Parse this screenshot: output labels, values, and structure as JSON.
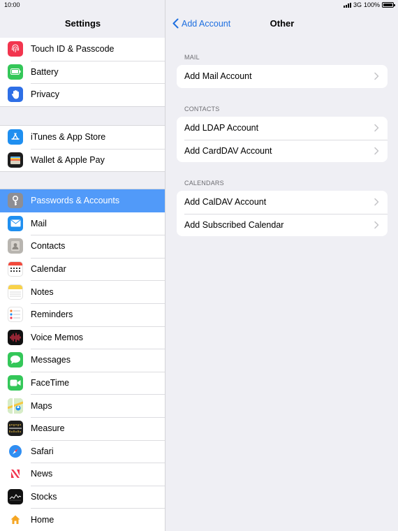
{
  "status_bar": {
    "time": "10:00",
    "network": "3G",
    "battery": "100%"
  },
  "sidebar": {
    "title": "Settings",
    "groups": [
      [
        {
          "label": "Touch ID & Passcode",
          "icon": "fingerprint-icon",
          "color": "#f2354e"
        },
        {
          "label": "Battery",
          "icon": "battery-icon",
          "color": "#34c759"
        },
        {
          "label": "Privacy",
          "icon": "hand-icon",
          "color": "#2e6fe6"
        }
      ],
      [
        {
          "label": "iTunes & App Store",
          "icon": "app-store-icon",
          "color": "#1f8ff0"
        },
        {
          "label": "Wallet & Apple Pay",
          "icon": "wallet-icon",
          "color": "#1d1d1d"
        }
      ],
      [
        {
          "label": "Passwords & Accounts",
          "icon": "key-icon",
          "color": "#8e8e93",
          "selected": true
        },
        {
          "label": "Mail",
          "icon": "mail-icon",
          "color": "#1f8ff0"
        },
        {
          "label": "Contacts",
          "icon": "contacts-icon",
          "color": "#b8b5b0"
        },
        {
          "label": "Calendar",
          "icon": "calendar-icon",
          "color": "#ffffff"
        },
        {
          "label": "Notes",
          "icon": "notes-icon",
          "color": "#ffffff"
        },
        {
          "label": "Reminders",
          "icon": "reminders-icon",
          "color": "#ffffff"
        },
        {
          "label": "Voice Memos",
          "icon": "voice-memos-icon",
          "color": "#111111"
        },
        {
          "label": "Messages",
          "icon": "messages-icon",
          "color": "#34c759"
        },
        {
          "label": "FaceTime",
          "icon": "facetime-icon",
          "color": "#34c759"
        },
        {
          "label": "Maps",
          "icon": "maps-icon",
          "color": "#8ad26c"
        },
        {
          "label": "Measure",
          "icon": "measure-icon",
          "color": "#1d1d1d"
        },
        {
          "label": "Safari",
          "icon": "safari-icon",
          "color": "#1f8ff0"
        },
        {
          "label": "News",
          "icon": "news-icon",
          "color": "#ffffff"
        },
        {
          "label": "Stocks",
          "icon": "stocks-icon",
          "color": "#111111"
        },
        {
          "label": "Home",
          "icon": "home-icon",
          "color": "#ffffff"
        }
      ]
    ]
  },
  "detail": {
    "back_label": "Add Account",
    "title": "Other",
    "sections": [
      {
        "header": "MAIL",
        "items": [
          "Add Mail Account"
        ]
      },
      {
        "header": "CONTACTS",
        "items": [
          "Add LDAP Account",
          "Add CardDAV Account"
        ]
      },
      {
        "header": "CALENDARS",
        "items": [
          "Add CalDAV Account",
          "Add Subscribed Calendar"
        ]
      }
    ]
  },
  "colors": {
    "accent": "#1e6fe0",
    "selected_row": "#519af9"
  }
}
